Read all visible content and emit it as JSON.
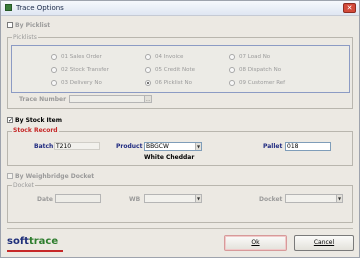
{
  "window": {
    "title": "Trace Options",
    "close_glyph": "✕"
  },
  "by_picklist": {
    "label": "By Picklist",
    "checked": false
  },
  "picklists": {
    "title": "Picklists",
    "options": [
      {
        "label": "01 Sales Order",
        "selected": false
      },
      {
        "label": "04 Invoice",
        "selected": false
      },
      {
        "label": "07 Load No",
        "selected": false
      },
      {
        "label": "02 Stock Transfer",
        "selected": false
      },
      {
        "label": "05 Credit Note",
        "selected": false
      },
      {
        "label": "08 Dispatch No",
        "selected": false
      },
      {
        "label": "03 Delivery No",
        "selected": false
      },
      {
        "label": "06 Picklist No",
        "selected": true
      },
      {
        "label": "09 Customer Ref",
        "selected": false
      }
    ],
    "trace_number_label": "Trace Number",
    "trace_number_value": ""
  },
  "by_stock_item": {
    "label": "By Stock Item",
    "checked": true
  },
  "stock_record": {
    "title": "Stock Record",
    "title_color": "#c62828",
    "batch_label": "Batch",
    "batch_value": "T210",
    "product_label": "Product",
    "product_value": "BBGCW",
    "product_description": "White Cheddar",
    "pallet_label": "Pallet",
    "pallet_value": "018"
  },
  "by_weighbridge_docket": {
    "label": "By Weighbridge Docket",
    "checked": false
  },
  "docket": {
    "title": "Docket",
    "date_label": "Date",
    "date_value": "",
    "wb_label": "WB",
    "wb_value": "",
    "docket_label": "Docket",
    "docket_value": ""
  },
  "buttons": {
    "ok_label": "Ok",
    "cancel_label": "Cancel"
  },
  "logo": {
    "soft": "soft",
    "trace": "trace"
  },
  "icons": {
    "checkmark": "✓",
    "dropdown": "▼"
  }
}
